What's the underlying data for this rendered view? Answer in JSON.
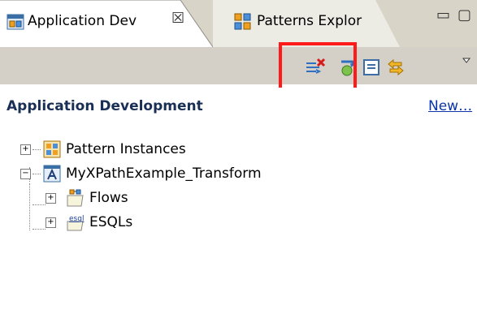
{
  "tabs": [
    {
      "label": "Application Dev",
      "icon": "application-development-icon",
      "active": true,
      "close_glyph": "☒"
    },
    {
      "label": "Patterns Explor",
      "icon": "patterns-explorer-icon",
      "active": false
    }
  ],
  "window_controls": {
    "minimize": "▭",
    "maximize": "▢"
  },
  "toolbar": {
    "buttons": [
      {
        "name": "remove-broken-references-icon",
        "tooltip": ""
      },
      {
        "name": "refresh-icon",
        "tooltip": ""
      },
      {
        "name": "collapse-all-icon",
        "tooltip": ""
      },
      {
        "name": "link-with-editor-icon",
        "tooltip": ""
      },
      {
        "name": "view-menu-icon",
        "tooltip": ""
      }
    ],
    "highlight_color": "#ff1a1a"
  },
  "header": {
    "title": "Application Development",
    "new_link": "New…"
  },
  "tree": [
    {
      "label": "Pattern Instances",
      "icon": "pattern-instances-icon",
      "expander": "+",
      "depth": 0
    },
    {
      "label": "MyXPathExample_Transform",
      "icon": "application-icon",
      "expander": "−",
      "depth": 0
    },
    {
      "label": "Flows",
      "icon": "flows-folder-icon",
      "expander": "+",
      "depth": 1
    },
    {
      "label": "ESQLs",
      "icon": "esql-folder-icon",
      "expander": "+",
      "depth": 1
    }
  ],
  "colors": {
    "tab_bar_bg": "#d8d4c8",
    "toolbar_bg": "#d4d0c8",
    "header_title": "#1a2f55",
    "link": "#0b34a8"
  }
}
